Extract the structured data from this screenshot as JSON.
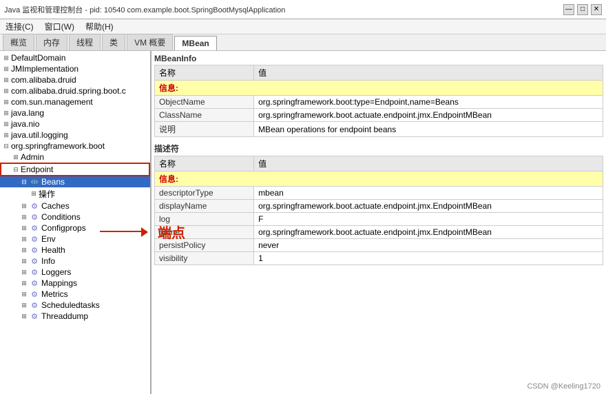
{
  "titleBar": {
    "text": "Java 监视和管理控制台 - pid: 10540  com.example.boot.SpringBootMysqlApplication",
    "minimizeLabel": "—",
    "maximizeLabel": "□",
    "closeLabel": "✕"
  },
  "menuBar": {
    "items": [
      "连接(C)",
      "窗口(W)",
      "帮助(H)"
    ]
  },
  "tabs": [
    {
      "label": "概览",
      "active": false
    },
    {
      "label": "内存",
      "active": false
    },
    {
      "label": "线程",
      "active": false
    },
    {
      "label": "类",
      "active": false
    },
    {
      "label": "VM 概要",
      "active": false
    },
    {
      "label": "MBean",
      "active": true
    }
  ],
  "tree": {
    "nodes": [
      {
        "id": "DefaultDomain",
        "label": "DefaultDomain",
        "indent": 0,
        "hasExpand": true,
        "icon": "folder",
        "expanded": false
      },
      {
        "id": "JMImplementation",
        "label": "JMImplementation",
        "indent": 0,
        "hasExpand": true,
        "icon": "folder",
        "expanded": false
      },
      {
        "id": "com.alibaba.druid",
        "label": "com.alibaba.druid",
        "indent": 0,
        "hasExpand": true,
        "icon": "folder",
        "expanded": false
      },
      {
        "id": "com.alibaba.druid.spring.boot",
        "label": "com.alibaba.druid.spring.boot.c",
        "indent": 0,
        "hasExpand": true,
        "icon": "folder",
        "expanded": false
      },
      {
        "id": "com.sun.management",
        "label": "com.sun.management",
        "indent": 0,
        "hasExpand": true,
        "icon": "folder",
        "expanded": false
      },
      {
        "id": "java.lang",
        "label": "java.lang",
        "indent": 0,
        "hasExpand": true,
        "icon": "folder",
        "expanded": false
      },
      {
        "id": "java.nio",
        "label": "java.nio",
        "indent": 0,
        "hasExpand": true,
        "icon": "folder",
        "expanded": false
      },
      {
        "id": "java.util.logging",
        "label": "java.util.logging",
        "indent": 0,
        "hasExpand": true,
        "icon": "folder",
        "expanded": false
      },
      {
        "id": "org.springframework.boot",
        "label": "org.springframework.boot",
        "indent": 0,
        "hasExpand": true,
        "icon": "folder",
        "expanded": true
      },
      {
        "id": "Admin",
        "label": "Admin",
        "indent": 1,
        "hasExpand": true,
        "icon": "folder",
        "expanded": false
      },
      {
        "id": "Endpoint",
        "label": "Endpoint",
        "indent": 1,
        "hasExpand": true,
        "icon": "folder",
        "expanded": true,
        "boxed": true
      },
      {
        "id": "Beans",
        "label": "Beans",
        "indent": 2,
        "hasExpand": true,
        "icon": "bean",
        "expanded": true,
        "selected": true
      },
      {
        "id": "操作",
        "label": "操作",
        "indent": 3,
        "hasExpand": false,
        "icon": "folder"
      },
      {
        "id": "Caches",
        "label": "Caches",
        "indent": 2,
        "hasExpand": true,
        "icon": "gear"
      },
      {
        "id": "Conditions",
        "label": "Conditions",
        "indent": 2,
        "hasExpand": true,
        "icon": "gear"
      },
      {
        "id": "Configprops",
        "label": "Configprops",
        "indent": 2,
        "hasExpand": true,
        "icon": "gear"
      },
      {
        "id": "Env",
        "label": "Env",
        "indent": 2,
        "hasExpand": true,
        "icon": "gear"
      },
      {
        "id": "Health",
        "label": "Health",
        "indent": 2,
        "hasExpand": true,
        "icon": "gear"
      },
      {
        "id": "Info",
        "label": "Info",
        "indent": 2,
        "hasExpand": true,
        "icon": "gear"
      },
      {
        "id": "Loggers",
        "label": "Loggers",
        "indent": 2,
        "hasExpand": true,
        "icon": "gear"
      },
      {
        "id": "Mappings",
        "label": "Mappings",
        "indent": 2,
        "hasExpand": true,
        "icon": "gear"
      },
      {
        "id": "Metrics",
        "label": "Metrics",
        "indent": 2,
        "hasExpand": true,
        "icon": "gear"
      },
      {
        "id": "Scheduledtasks",
        "label": "Scheduledtasks",
        "indent": 2,
        "hasExpand": true,
        "icon": "gear"
      },
      {
        "id": "Threaddump",
        "label": "Threaddump",
        "indent": 2,
        "hasExpand": true,
        "icon": "gear"
      }
    ]
  },
  "mbeanInfo": {
    "title": "MBeanInfo",
    "infoTable": {
      "columns": [
        "名称",
        "值"
      ],
      "headerRow": "信息:",
      "rows": [
        {
          "name": "ObjectName",
          "value": "org.springframework.boot:type=Endpoint,name=Beans"
        },
        {
          "name": "ClassName",
          "value": "org.springframework.boot.actuate.endpoint.jmx.EndpointMBean"
        },
        {
          "name": "说明",
          "value": "MBean operations for endpoint beans"
        }
      ]
    },
    "descriptorTitle": "描述符",
    "descriptorTable": {
      "columns": [
        "名称",
        "值"
      ],
      "headerRow": "信息:",
      "rows": [
        {
          "name": "descriptorType",
          "value": "mbean"
        },
        {
          "name": "displayName",
          "value": "org.springframework.boot.actuate.endpoint.jmx.EndpointMBean"
        },
        {
          "name": "log",
          "value": "F"
        },
        {
          "name": "name",
          "value": "org.springframework.boot.actuate.endpoint.jmx.EndpointMBean"
        },
        {
          "name": "persistPolicy",
          "value": "never"
        },
        {
          "name": "visibility",
          "value": "1"
        }
      ]
    }
  },
  "annotation": {
    "text": "端点"
  },
  "watermark": "CSDN @Keeling1720"
}
